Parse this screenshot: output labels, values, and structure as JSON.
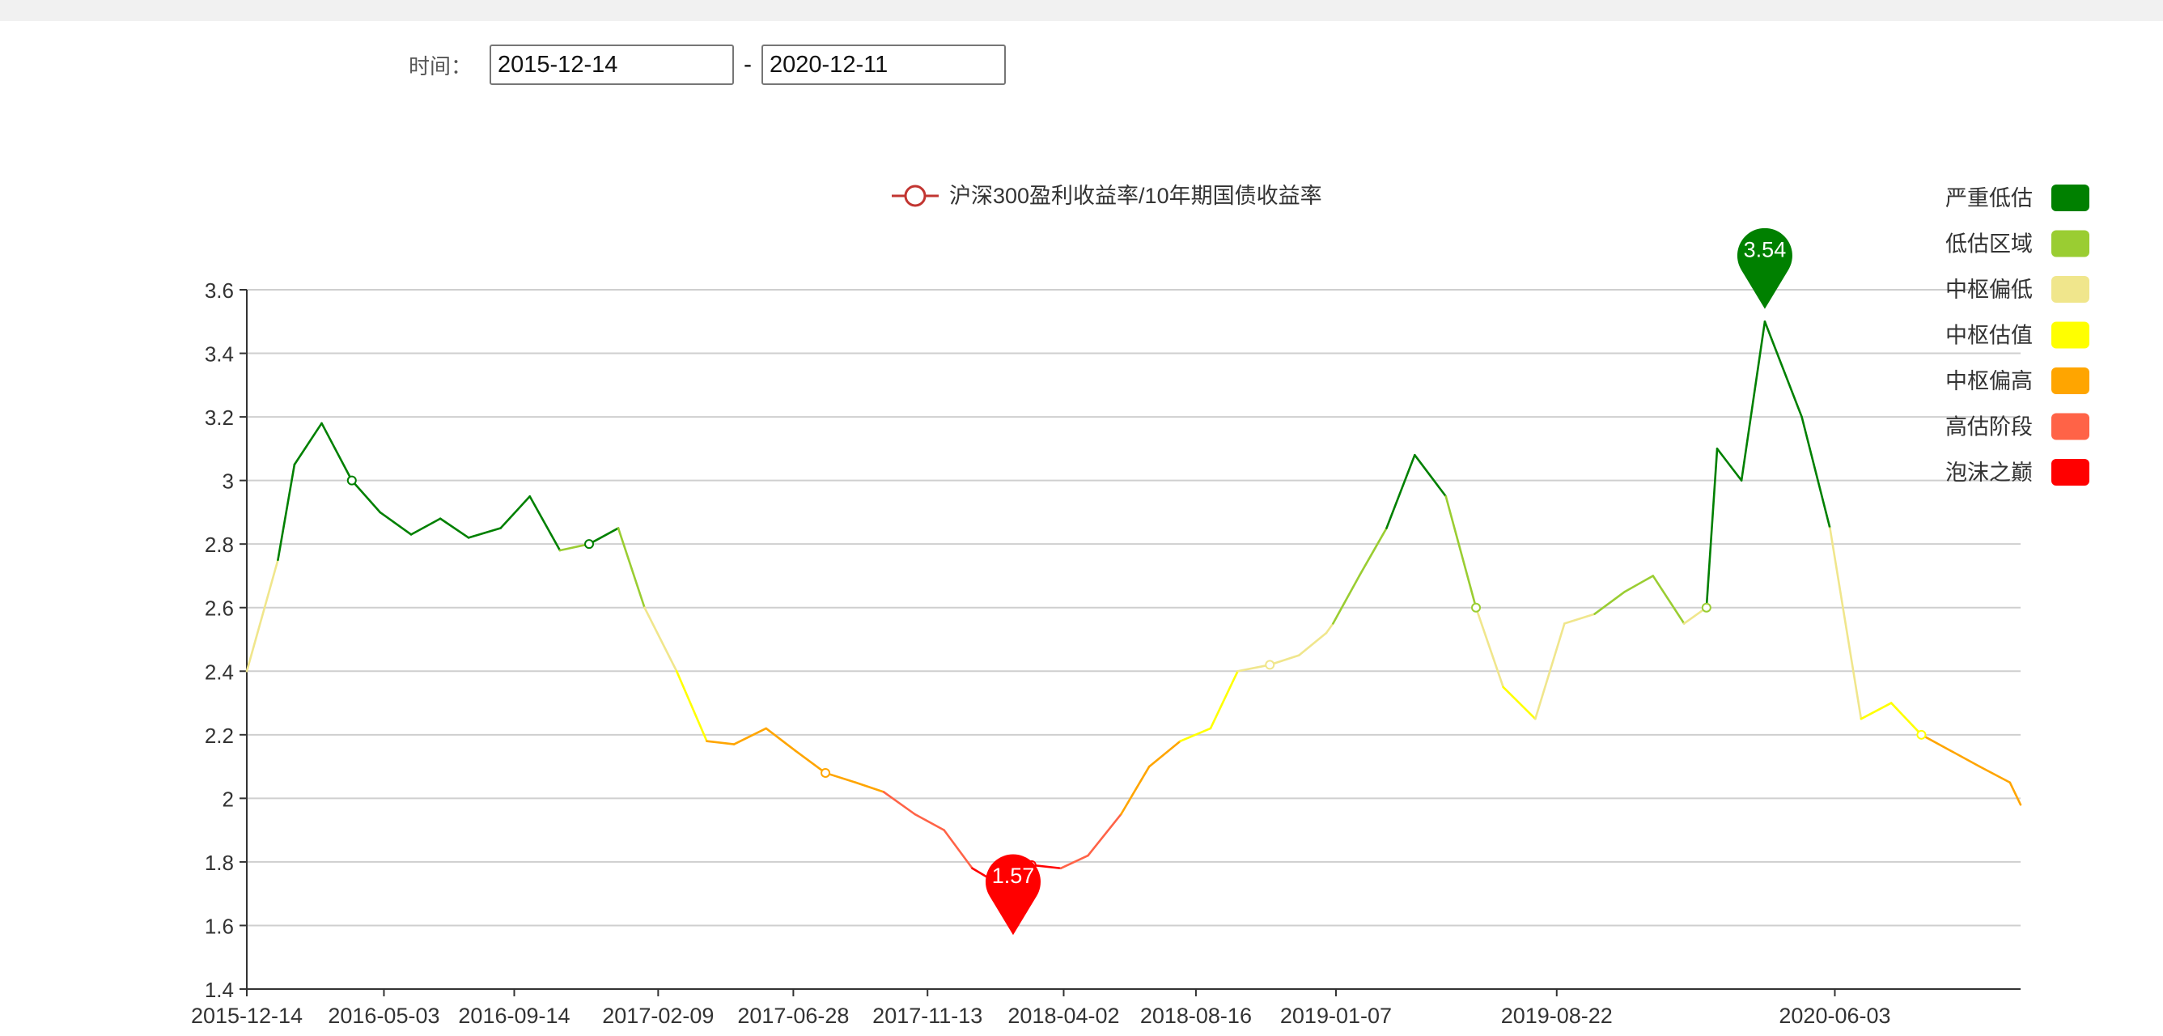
{
  "filter": {
    "label": "时间：",
    "start": "2015-12-14",
    "separator": "-",
    "end": "2020-12-11"
  },
  "chart_data": {
    "type": "line",
    "series": [
      {
        "name": "沪深300盈利收益率/10年期国债收益率"
      }
    ],
    "ylim": [
      1.4,
      3.6
    ],
    "yticks": [
      "1.4",
      "1.6",
      "1.8",
      "2",
      "2.2",
      "2.4",
      "2.6",
      "2.8",
      "3",
      "3.2",
      "3.4",
      "3.6"
    ],
    "xticks": [
      "2015-12-14",
      "2016-05-03",
      "2016-09-14",
      "2017-02-09",
      "2017-06-28",
      "2017-11-13",
      "2018-04-02",
      "2018-08-16",
      "2019-01-07",
      "2019-08-22",
      "2020-06-03"
    ],
    "x": [
      "2015-12-14",
      "2016-01-15",
      "2016-02-01",
      "2016-02-29",
      "2016-03-31",
      "2016-04-29",
      "2016-05-31",
      "2016-06-30",
      "2016-07-29",
      "2016-08-31",
      "2016-09-30",
      "2016-10-31",
      "2016-11-30",
      "2016-12-30",
      "2017-01-26",
      "2017-02-28",
      "2017-03-31",
      "2017-04-28",
      "2017-05-31",
      "2017-06-30",
      "2017-07-31",
      "2017-08-31",
      "2017-09-29",
      "2017-10-31",
      "2017-11-30",
      "2017-12-29",
      "2018-01-31",
      "2018-02-09",
      "2018-02-28",
      "2018-03-30",
      "2018-04-27",
      "2018-05-31",
      "2018-06-29",
      "2018-07-31",
      "2018-08-31",
      "2018-09-28",
      "2018-10-31",
      "2018-11-30",
      "2018-12-28",
      "2019-01-04",
      "2019-01-31",
      "2019-02-28",
      "2019-03-29",
      "2019-04-30",
      "2019-05-31",
      "2019-06-28",
      "2019-07-31",
      "2019-08-30",
      "2019-09-30",
      "2019-10-31",
      "2019-11-29",
      "2019-12-31",
      "2020-01-23",
      "2020-02-03",
      "2020-02-28",
      "2020-03-23",
      "2020-04-30",
      "2020-05-29",
      "2020-06-30",
      "2020-07-31",
      "2020-08-31",
      "2020-09-30",
      "2020-10-30",
      "2020-11-30",
      "2020-12-11"
    ],
    "values": [
      2.4,
      2.75,
      3.05,
      3.18,
      3.0,
      2.9,
      2.83,
      2.88,
      2.82,
      2.85,
      2.95,
      2.78,
      2.8,
      2.85,
      2.6,
      2.4,
      2.18,
      2.17,
      2.22,
      2.15,
      2.08,
      2.05,
      2.02,
      1.95,
      1.9,
      1.78,
      1.72,
      1.76,
      1.79,
      1.78,
      1.82,
      1.95,
      2.1,
      2.18,
      2.22,
      2.4,
      2.42,
      2.45,
      2.52,
      2.55,
      2.7,
      2.85,
      3.08,
      2.95,
      2.6,
      2.35,
      2.25,
      2.55,
      2.58,
      2.65,
      2.7,
      2.55,
      2.6,
      3.1,
      3.0,
      3.5,
      3.2,
      2.85,
      2.25,
      2.3,
      2.2,
      2.15,
      2.1,
      2.05,
      1.98
    ],
    "markers": [
      {
        "label": "3.54",
        "x": "2020-03-23",
        "value": 3.54,
        "color": "#008000"
      },
      {
        "label": "1.57",
        "x": "2018-02-09",
        "value": 1.57,
        "color": "#ff0000"
      }
    ],
    "visual_map": [
      {
        "label": "严重低估",
        "min": 2.8,
        "max": null,
        "color": "#008000"
      },
      {
        "label": "低估区域",
        "min": 2.6,
        "max": 2.8,
        "color": "#9acd32"
      },
      {
        "label": "中枢偏低",
        "min": 2.4,
        "max": 2.6,
        "color": "#f0e68c"
      },
      {
        "label": "中枢估值",
        "min": 2.2,
        "max": 2.4,
        "color": "#ffff00"
      },
      {
        "label": "中枢偏高",
        "min": 2.0,
        "max": 2.2,
        "color": "#ffa500"
      },
      {
        "label": "高估阶段",
        "min": 1.8,
        "max": 2.0,
        "color": "#ff6347"
      },
      {
        "label": "泡沫之巅",
        "min": null,
        "max": 1.8,
        "color": "#ff0000"
      }
    ],
    "grid": true,
    "legend_position": "top-center"
  }
}
